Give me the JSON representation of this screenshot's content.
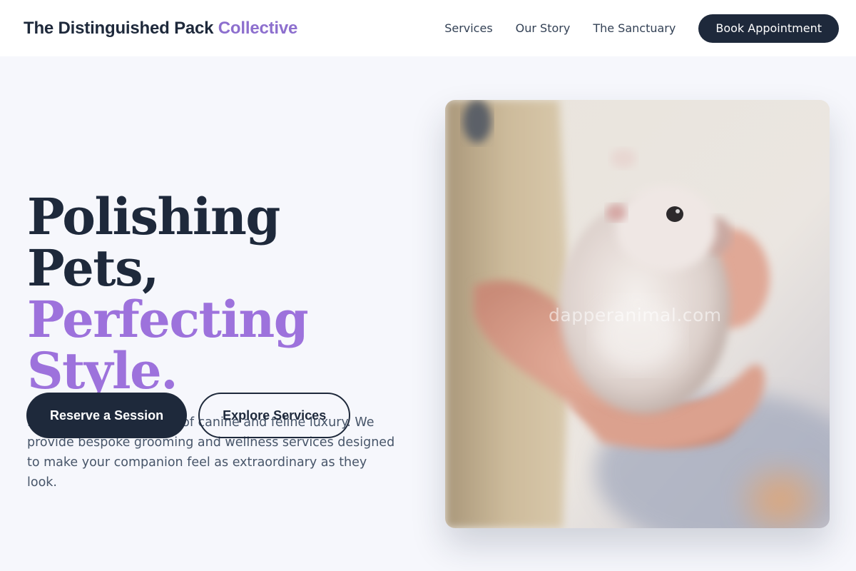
{
  "header": {
    "brand_main": "The Distinguished Pack",
    "brand_accent": "Collective",
    "nav": [
      {
        "label": "Services"
      },
      {
        "label": "Our Story"
      },
      {
        "label": "The Sanctuary"
      }
    ],
    "book_label": "Book Appointment"
  },
  "hero": {
    "headline_line1": "Polishing Pets,",
    "headline_line2": "Perfecting Style.",
    "lead": "Experience the pinnacle of canine and feline luxury. We provide bespoke grooming and wellness services designed to make your companion feel as extraordinary as they look.",
    "primary_cta": "Reserve a Session",
    "secondary_cta": "Explore Services",
    "image_watermark": "dapperanimal.com"
  },
  "colors": {
    "navy": "#1e293b",
    "accent_purple": "#9d72dc",
    "background": "#f6f7fc"
  },
  "icons": []
}
